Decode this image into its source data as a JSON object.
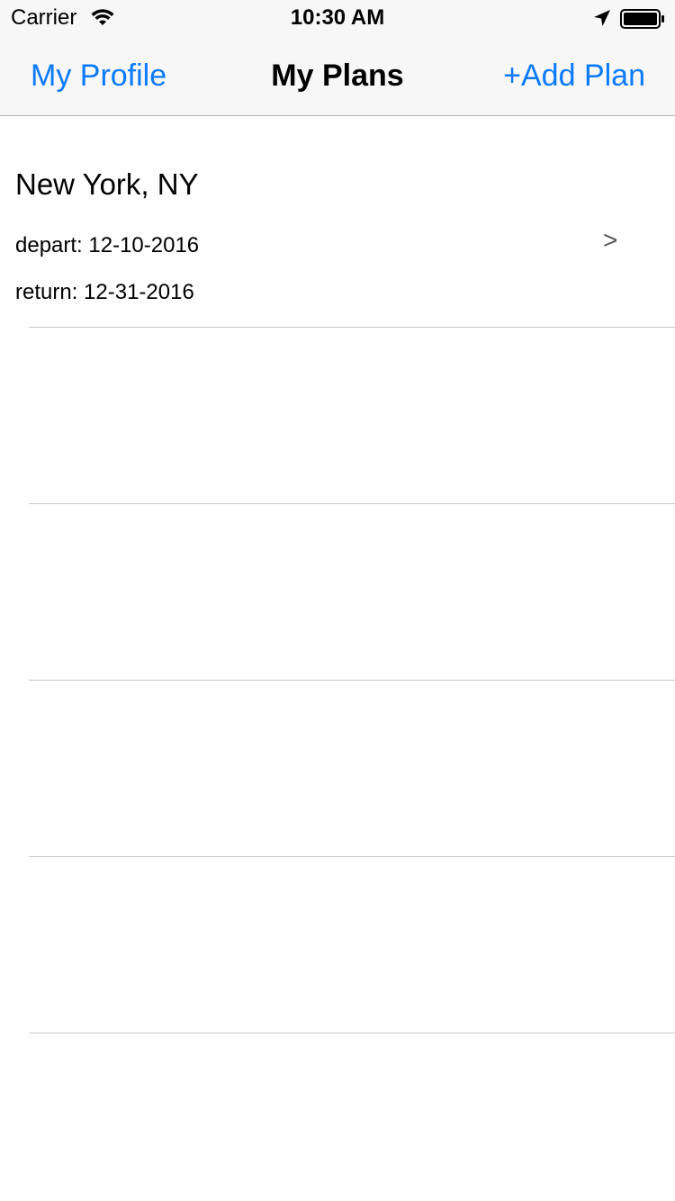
{
  "status_bar": {
    "carrier": "Carrier",
    "time": "10:30 AM",
    "icons": [
      "wifi-icon",
      "location-arrow-icon",
      "battery-icon"
    ]
  },
  "nav": {
    "left_button": "My Profile",
    "title": "My Plans",
    "right_button": "+Add Plan"
  },
  "plans": [
    {
      "city": "New York, NY",
      "depart": "depart: 12-10-2016",
      "return": "return: 12-31-2016",
      "chevron": ">"
    }
  ],
  "colors": {
    "accent": "#0a7aff",
    "bar_background": "#f7f7f7",
    "separator": "#c8c7cc"
  }
}
